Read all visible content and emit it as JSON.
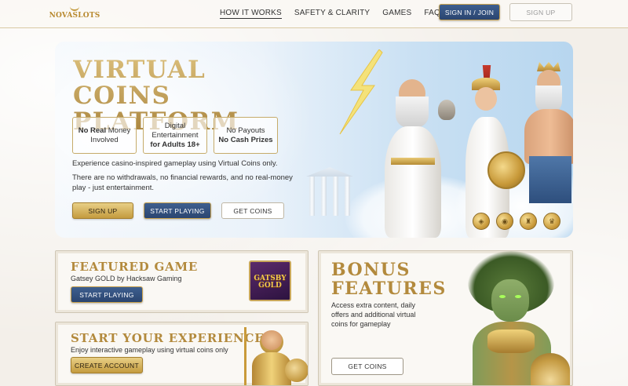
{
  "brand": {
    "logo_text": "NOVASLOTS"
  },
  "nav": {
    "links": [
      {
        "label": "HOW IT WORKS",
        "active": true
      },
      {
        "label": "SAFETY & CLARITY",
        "active": false
      },
      {
        "label": "GAMES",
        "active": false
      },
      {
        "label": "FAQ",
        "active": false
      }
    ],
    "sign_in_label": "SIGN IN / JOIN",
    "sign_up_label": "SIGN UP"
  },
  "hero": {
    "title_line1": "VIRTUAL COINS",
    "title_line2": "PLATFORM",
    "features": [
      {
        "line1_bold": "No Real",
        "line1_rest": " Money",
        "line2": "Involved"
      },
      {
        "line1": "Digital",
        "line2": "Entertainment",
        "line3_bold": "for Adults 18+"
      },
      {
        "line1": "No Payouts",
        "line2_bold": "No Cash Prizes"
      }
    ],
    "text1": "Experience casino-inspired gameplay using Virtual Coins only.",
    "text2": "There are no withdrawals, no financial rewards, and no real-money play - just entertainment.",
    "buttons": {
      "sign_up": "SIGN UP",
      "start_playing": "START PLAYING",
      "get_coins": "GET COINS"
    },
    "icons": [
      "shield-coin-icon",
      "chat-coin-icon",
      "trophy-coin-icon",
      "crown-coin-icon"
    ]
  },
  "featured": {
    "title": "FEATURED GAME",
    "subtitle": "Gatsey GOLD by Hacksaw Gaming",
    "button": "START PLAYING",
    "thumb_text_line1": "GATSBY",
    "thumb_text_line2": "GOLD"
  },
  "experience": {
    "title": "START YOUR EXPERIENCE",
    "subtitle": "Enjoy interactive gameplay using virtual coins only",
    "button": "CREATE ACCOUNT"
  },
  "bonus": {
    "title_line1": "BONUS",
    "title_line2": "FEATURES",
    "text": "Access extra content, daily offers and additional virtual coins for gameplay",
    "button": "GET COINS"
  },
  "colors": {
    "gold": "#c49b3e",
    "navy": "#2b4570",
    "sky": "#b7d6ef"
  }
}
